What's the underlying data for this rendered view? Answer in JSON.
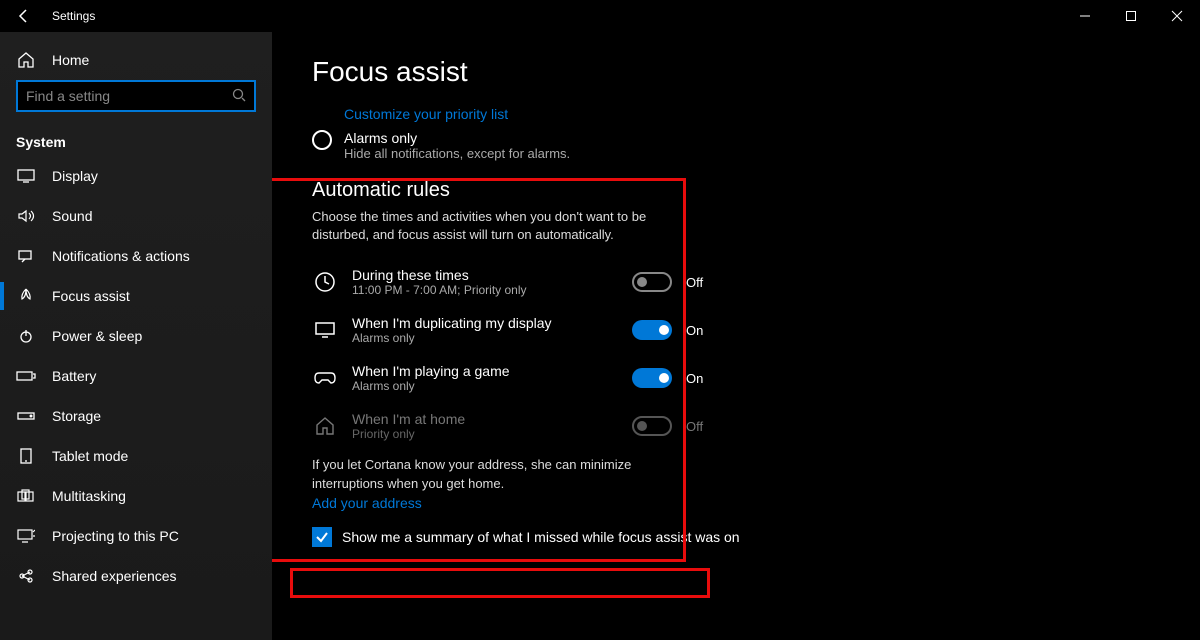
{
  "window": {
    "app_title": "Settings"
  },
  "search": {
    "placeholder": "Find a setting"
  },
  "sidebar": {
    "home": "Home",
    "section": "System",
    "items": [
      {
        "label": "Display"
      },
      {
        "label": "Sound"
      },
      {
        "label": "Notifications & actions"
      },
      {
        "label": "Focus assist"
      },
      {
        "label": "Power & sleep"
      },
      {
        "label": "Battery"
      },
      {
        "label": "Storage"
      },
      {
        "label": "Tablet mode"
      },
      {
        "label": "Multitasking"
      },
      {
        "label": "Projecting to this PC"
      },
      {
        "label": "Shared experiences"
      }
    ]
  },
  "page": {
    "title": "Focus assist",
    "customize_link": "Customize your priority list",
    "alarms_only": {
      "title": "Alarms only",
      "sub": "Hide all notifications, except for alarms."
    },
    "auto_rules": {
      "heading": "Automatic rules",
      "desc": "Choose the times and activities when you don't want to be disturbed, and focus assist will turn on automatically.",
      "rules": [
        {
          "title": "During these times",
          "sub": "11:00 PM - 7:00 AM; Priority only",
          "state": "Off"
        },
        {
          "title": "When I'm duplicating my display",
          "sub": "Alarms only",
          "state": "On"
        },
        {
          "title": "When I'm playing a game",
          "sub": "Alarms only",
          "state": "On"
        },
        {
          "title": "When I'm at home",
          "sub": "Priority only",
          "state": "Off"
        }
      ],
      "cortana_note": "If you let Cortana know your address, she can minimize interruptions when you get home.",
      "add_address": "Add your address"
    },
    "summary_checkbox": "Show me a summary of what I missed while focus assist was on"
  }
}
